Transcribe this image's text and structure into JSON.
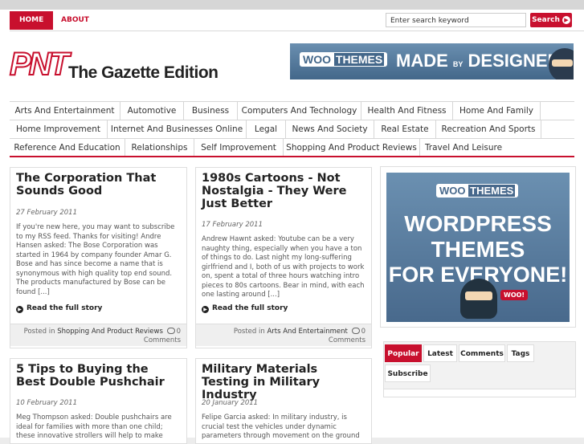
{
  "topnav": {
    "home": "HOME",
    "about": "ABOUT"
  },
  "search": {
    "value": "Enter search keyword",
    "button": "Search"
  },
  "site": {
    "logo_mark": "PNT",
    "title": "The Gazette Edition"
  },
  "header_ad": {
    "brand_a": "WOO",
    "brand_b": "THEMES",
    "slogan_a": "MADE",
    "slogan_by": "BY",
    "slogan_b": "DESIGNERS"
  },
  "categories": [
    [
      "Arts And Entertainment",
      "Automotive",
      "Business",
      "Computers And Technology",
      "Health And Fitness",
      "Home And Family"
    ],
    [
      "Home Improvement",
      "Internet And Businesses Online",
      "Legal",
      "News And Society",
      "Real Estate",
      "Recreation And Sports"
    ],
    [
      "Reference And Education",
      "Relationships",
      "Self Improvement",
      "Shopping And Product Reviews",
      "Travel And Leisure"
    ]
  ],
  "posts": [
    {
      "title": "The Corporation That Sounds Good",
      "date": "27 February 2011",
      "excerpt": "If you're new here, you may want to subscribe to my RSS feed. Thanks for visiting! Andre Hansen asked: The Bose Corporation was started in 1964 by company founder Amar G. Bose and has since become a name that is synonymous with high quality top end sound. The products manufactured by Bose can be found [...]",
      "more": "Read the full story",
      "posted_in": "Posted in",
      "category": "Shopping And Product Reviews",
      "comments_count": "0",
      "comments_label": "Comments"
    },
    {
      "title": "1980s Cartoons - Not Nostalgia - They Were Just Better",
      "date": "17 February 2011",
      "excerpt": "Andrew Hawnt asked: Youtube can be a very naughty thing, especially when you have a ton of things to do. Last night my long-suffering girlfriend and I, both of us with projects to work on, spent a total of three hours watching intro pieces to 80s cartoons. Bear in mind, with each one lasting around [...]",
      "more": "Read the full story",
      "posted_in": "Posted in",
      "category": "Arts And Entertainment",
      "comments_count": "0",
      "comments_label": "Comments"
    },
    {
      "title": "5 Tips to Buying the Best Double Pushchair",
      "date": "10 February 2011",
      "excerpt": "Meg Thompson asked: Double pushchairs are ideal for families with more than one child; these innovative strollers will help to make"
    },
    {
      "title": "Military Materials Testing in Military Industry",
      "date": "20 January 2011",
      "excerpt": "Felipe Garcia asked: In military industry, is crucial test the vehicles under dynamic parameters through movement on the ground"
    }
  ],
  "sidebar_ad": {
    "brand_a": "WOO",
    "brand_b": "THEMES",
    "line1": "WORDPRESS",
    "line2": "THEMES",
    "line3": "FOR EVERYONE!",
    "bubble": "WOO!"
  },
  "tabs": [
    "Popular",
    "Latest",
    "Comments",
    "Tags",
    "Subscribe"
  ],
  "colors": {
    "accent": "#c8102e",
    "banner": "#43678a"
  }
}
